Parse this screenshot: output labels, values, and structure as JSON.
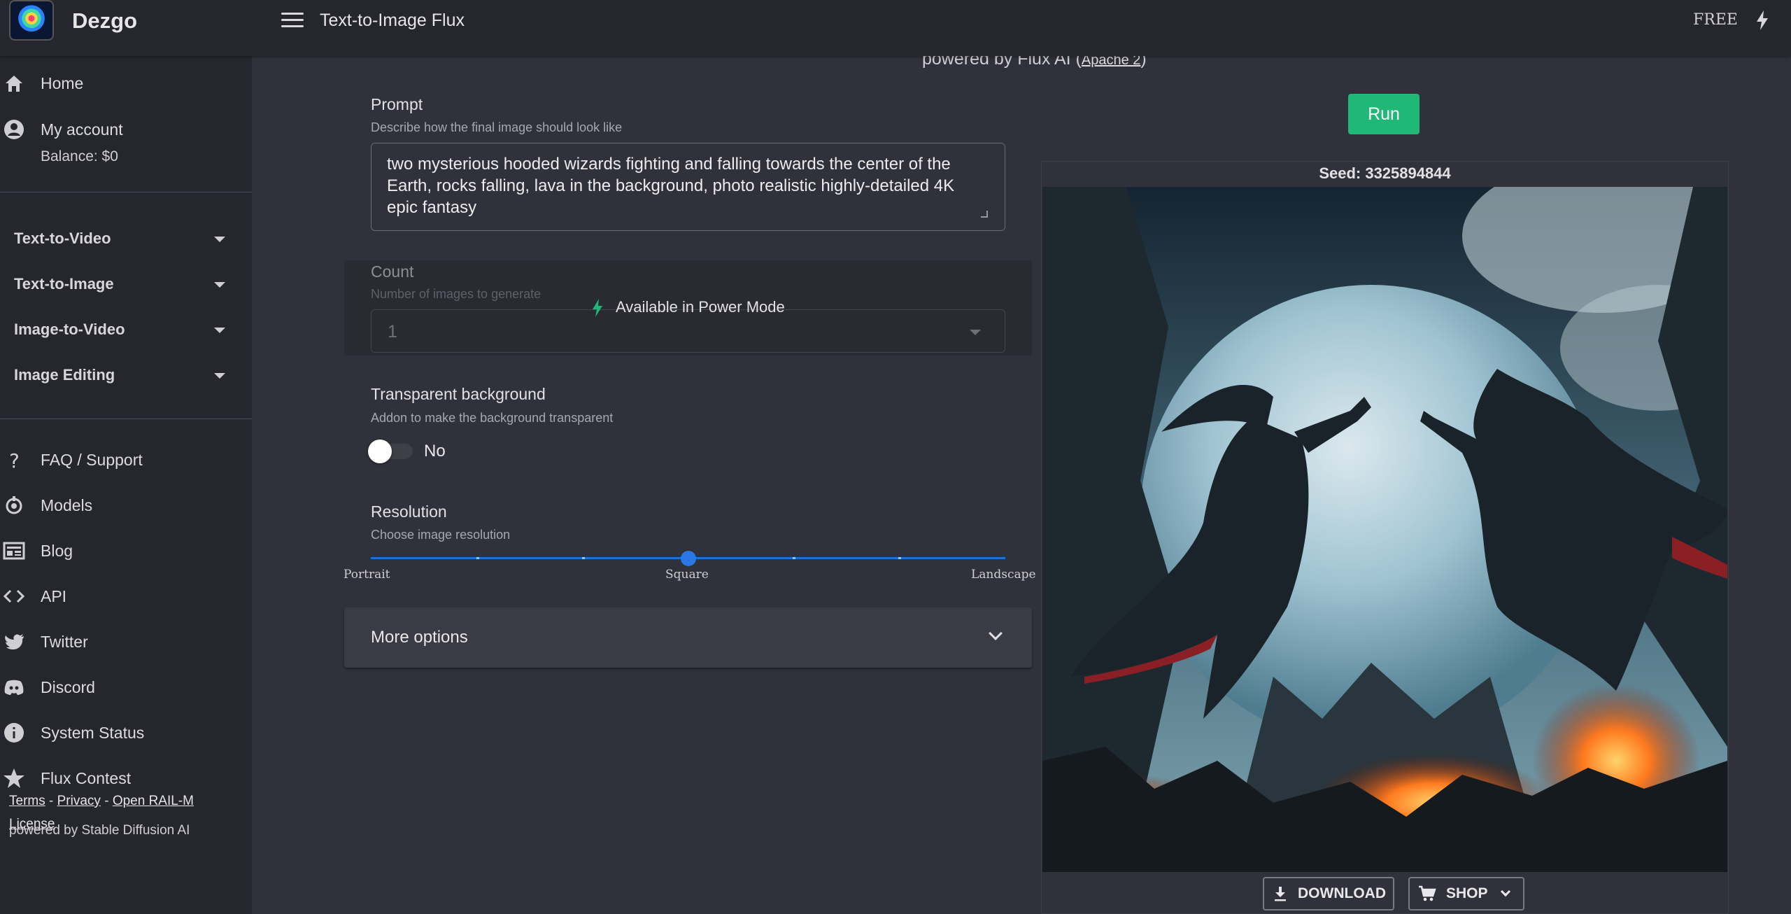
{
  "header": {
    "brand": "Dezgo",
    "page_title": "Text-to-Image Flux",
    "plan": "FREE"
  },
  "sidebar": {
    "items": [
      {
        "label": "Home",
        "icon": "home-icon"
      },
      {
        "label": "My account",
        "icon": "account-icon"
      }
    ],
    "balance": "Balance: $0",
    "groups": [
      {
        "label": "Text-to-Video"
      },
      {
        "label": "Text-to-Image"
      },
      {
        "label": "Image-to-Video"
      },
      {
        "label": "Image Editing"
      }
    ],
    "links": [
      {
        "label": "FAQ / Support",
        "icon": "question-icon"
      },
      {
        "label": "Models",
        "icon": "models-icon"
      },
      {
        "label": "Blog",
        "icon": "blog-icon"
      },
      {
        "label": "API",
        "icon": "code-icon"
      },
      {
        "label": "Twitter",
        "icon": "twitter-icon"
      },
      {
        "label": "Discord",
        "icon": "discord-icon"
      },
      {
        "label": "System Status",
        "icon": "info-icon"
      },
      {
        "label": "Flux Contest",
        "icon": "star-icon"
      }
    ],
    "footer": {
      "powered": "powered by Stable Diffusion AI",
      "terms": "Terms",
      "sep1": " - ",
      "privacy": "Privacy",
      "sep2": " - ",
      "license": "Open RAIL-M License"
    }
  },
  "main": {
    "powered_prefix": "powered by Flux AI (",
    "powered_link": "Apache 2",
    "powered_suffix": ")",
    "prompt": {
      "label": "Prompt",
      "helper": "Describe how the final image should look like",
      "value": "two mysterious hooded wizards fighting and falling towards the center of the Earth, rocks falling, lava in the background, photo realistic highly-detailed 4K epic fantasy"
    },
    "count": {
      "label": "Count",
      "helper": "Number of images to generate",
      "value": "1",
      "power_mode": "Available in Power Mode"
    },
    "transparent": {
      "label": "Transparent background",
      "helper": "Addon to make the background transparent",
      "value": "No"
    },
    "resolution": {
      "label": "Resolution",
      "helper": "Choose image resolution",
      "left": "Portrait",
      "middle": "Square",
      "right": "Landscape",
      "position": 0.5
    },
    "more_options": "More options"
  },
  "result": {
    "run_label": "Run",
    "seed": "Seed: 3325894844",
    "download_label": "DOWNLOAD",
    "shop_label": "SHOP"
  },
  "colors": {
    "accent_green": "#1fb876",
    "slider_blue": "#2b78e4",
    "background": "#30313a",
    "sidebar": "#26272e"
  }
}
